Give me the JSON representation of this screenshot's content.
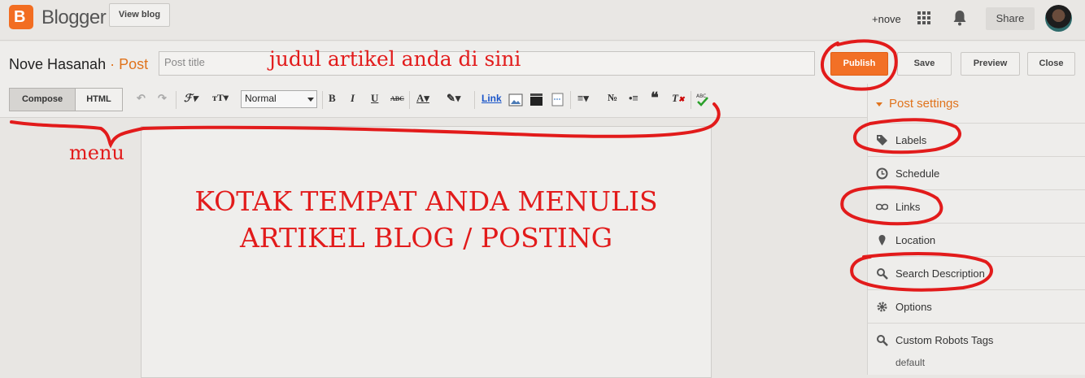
{
  "topbar": {
    "brand": "Blogger",
    "view_blog": "View blog",
    "user": "+nove",
    "share": "Share"
  },
  "editor_header": {
    "blog_name": "Nove Hasanah",
    "separator": "·",
    "section": "Post",
    "title_placeholder": "Post title",
    "publish": "Publish",
    "save": "Save",
    "preview": "Preview",
    "close": "Close"
  },
  "toolbar": {
    "compose": "Compose",
    "html": "HTML",
    "format": "Normal",
    "link": "Link"
  },
  "sidebar": {
    "title": "Post settings",
    "items": [
      {
        "label": "Labels",
        "icon": "tag-icon"
      },
      {
        "label": "Schedule",
        "icon": "clock-icon"
      },
      {
        "label": "Links",
        "icon": "link-icon"
      },
      {
        "label": "Location",
        "icon": "pin-icon"
      },
      {
        "label": "Search Description",
        "icon": "search-icon"
      },
      {
        "label": "Options",
        "icon": "gear-icon"
      },
      {
        "label": "Custom Robots Tags",
        "icon": "search-icon"
      }
    ],
    "robots_default": "default"
  },
  "annotations": {
    "judul": "judul artikel anda di sini",
    "menu": "menu",
    "kotak_line1": "KOTAK TEMPAT ANDA MENULIS",
    "kotak_line2": "ARTIKEL BLOG / POSTING"
  },
  "colors": {
    "accent": "#f27026",
    "annotation": "#e21b1b",
    "link": "#1a55c9"
  }
}
